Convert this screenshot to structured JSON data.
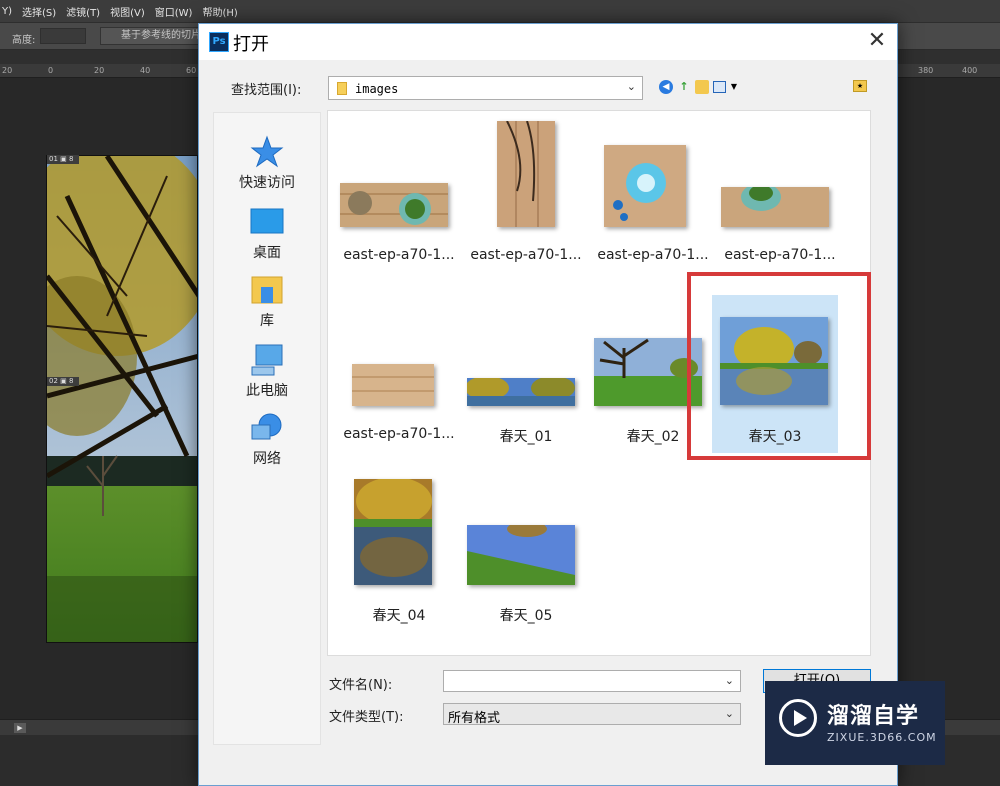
{
  "photoshop": {
    "menu": [
      "Y)",
      "选择(S)",
      "滤镜(T)",
      "视图(V)",
      "窗口(W)",
      "帮助(H)"
    ],
    "options": {
      "height_label": "高度:",
      "guides_button": "基于参考线的切片"
    },
    "ruler_ticks_left": [
      "20",
      "0",
      "20",
      "40",
      "60"
    ],
    "ruler_ticks_right": [
      "380",
      "400"
    ],
    "slice_tags": [
      "01 ▣ 8",
      "02 ▣ 8"
    ]
  },
  "dialog": {
    "title": "打开",
    "app_icon": "ps-icon",
    "look_in_label": "查找范围(I):",
    "look_in_value": "images",
    "places": [
      {
        "label": "快速访问",
        "icon": "quick-access-star-icon"
      },
      {
        "label": "桌面",
        "icon": "desktop-icon"
      },
      {
        "label": "库",
        "icon": "library-icon"
      },
      {
        "label": "此电脑",
        "icon": "this-pc-icon"
      },
      {
        "label": "网络",
        "icon": "network-icon"
      }
    ],
    "files": [
      {
        "label": "east-ep-a70-1..."
      },
      {
        "label": "east-ep-a70-1..."
      },
      {
        "label": "east-ep-a70-1..."
      },
      {
        "label": "east-ep-a70-1..."
      },
      {
        "label": "east-ep-a70-1..."
      },
      {
        "label": "春天_01"
      },
      {
        "label": "春天_02"
      },
      {
        "label": "春天_03",
        "selected": true
      },
      {
        "label": "春天_04"
      },
      {
        "label": "春天_05"
      }
    ],
    "file_name_label": "文件名(N):",
    "file_name_value": "",
    "file_type_label": "文件类型(T):",
    "file_type_value": "所有格式",
    "open_button": "打开(O)"
  },
  "watermark": {
    "brand": "溜溜自学",
    "url": "ZIXUE.3D66.COM"
  }
}
